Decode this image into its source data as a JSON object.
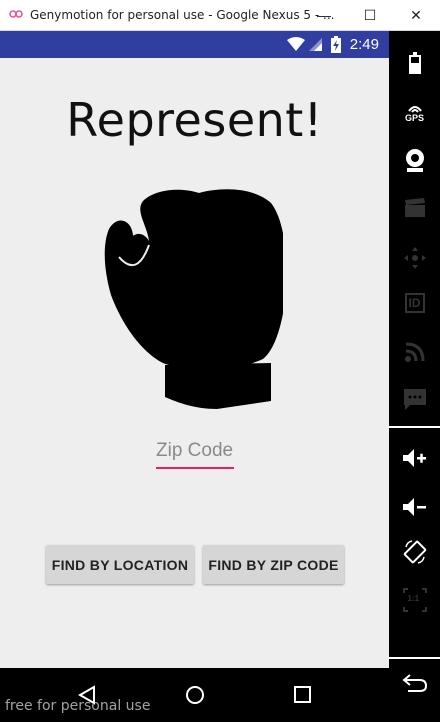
{
  "window": {
    "title": "Genymotion for personal use - Google Nexus 5 - ...",
    "minimize_glyph": "—",
    "maximize_glyph": "☐",
    "close_glyph": "✕"
  },
  "statusbar": {
    "time": "2:49",
    "background": "#303f9f"
  },
  "app": {
    "title": "Represent!",
    "zip_placeholder": "Zip Code",
    "accent": "#e91e63",
    "find_by_location_label": "FIND BY LOCATION",
    "find_by_zip_label": "FIND BY ZIP CODE"
  },
  "sidepanel": {
    "gps_label": "GPS",
    "id_label": "ID",
    "pixel_ratio_label": "1:1",
    "icons": [
      "battery-icon",
      "gps-icon",
      "camera-icon",
      "clapperboard-icon",
      "dpad-icon",
      "id-icon",
      "rss-icon",
      "sms-icon",
      "volume-up-icon",
      "volume-down-icon",
      "rotate-icon",
      "pixel-ratio-icon",
      "back-icon"
    ]
  },
  "watermark": "free for personal use"
}
